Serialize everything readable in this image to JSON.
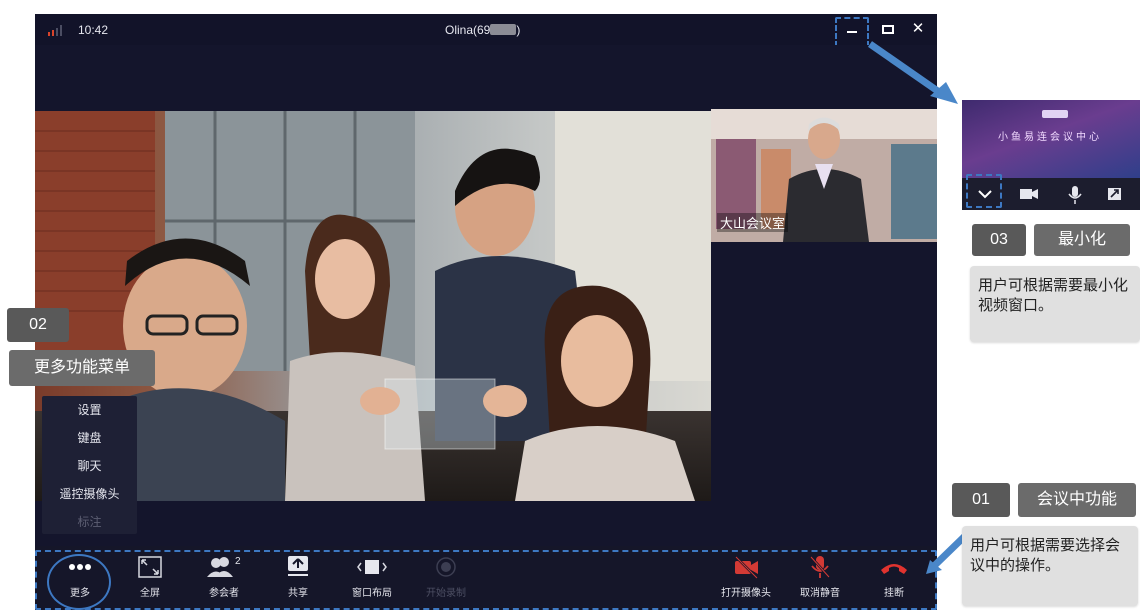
{
  "window": {
    "time": "10:42",
    "caller_prefix": "Olina(69",
    "caller_suffix": ")",
    "pip_label": "大山会议室"
  },
  "more_menu": {
    "items": [
      "设置",
      "键盘",
      "聊天",
      "遥控摄像头",
      "标注"
    ]
  },
  "toolbar": {
    "more": "更多",
    "fullscreen": "全屏",
    "participants": "参会者",
    "participants_count": "2",
    "share": "共享",
    "layout": "窗口布局",
    "record": "开始录制",
    "camera": "打开摄像头",
    "unmute": "取消静音",
    "hangup": "挂断"
  },
  "annotations": {
    "a01": {
      "num": "01",
      "title": "会议中功能",
      "desc": "用户可根据需要选择会议中的操作。"
    },
    "a02": {
      "num": "02",
      "title": "更多功能菜单"
    },
    "a03": {
      "num": "03",
      "title": "最小化",
      "desc": "用户可根据需要最小化视频窗口。"
    }
  },
  "mini_window": {
    "screen_text": "小鱼易连会议中心"
  },
  "colors": {
    "window_bg": "#14152c",
    "accent_dash": "#3d78c2",
    "arrow": "#4a87c9",
    "badge": "#595959",
    "pill": "#6b6b6b",
    "desc_bg": "#e0e0e0",
    "hangup_red": "#e0332f",
    "signal_red": "#d9442b"
  }
}
